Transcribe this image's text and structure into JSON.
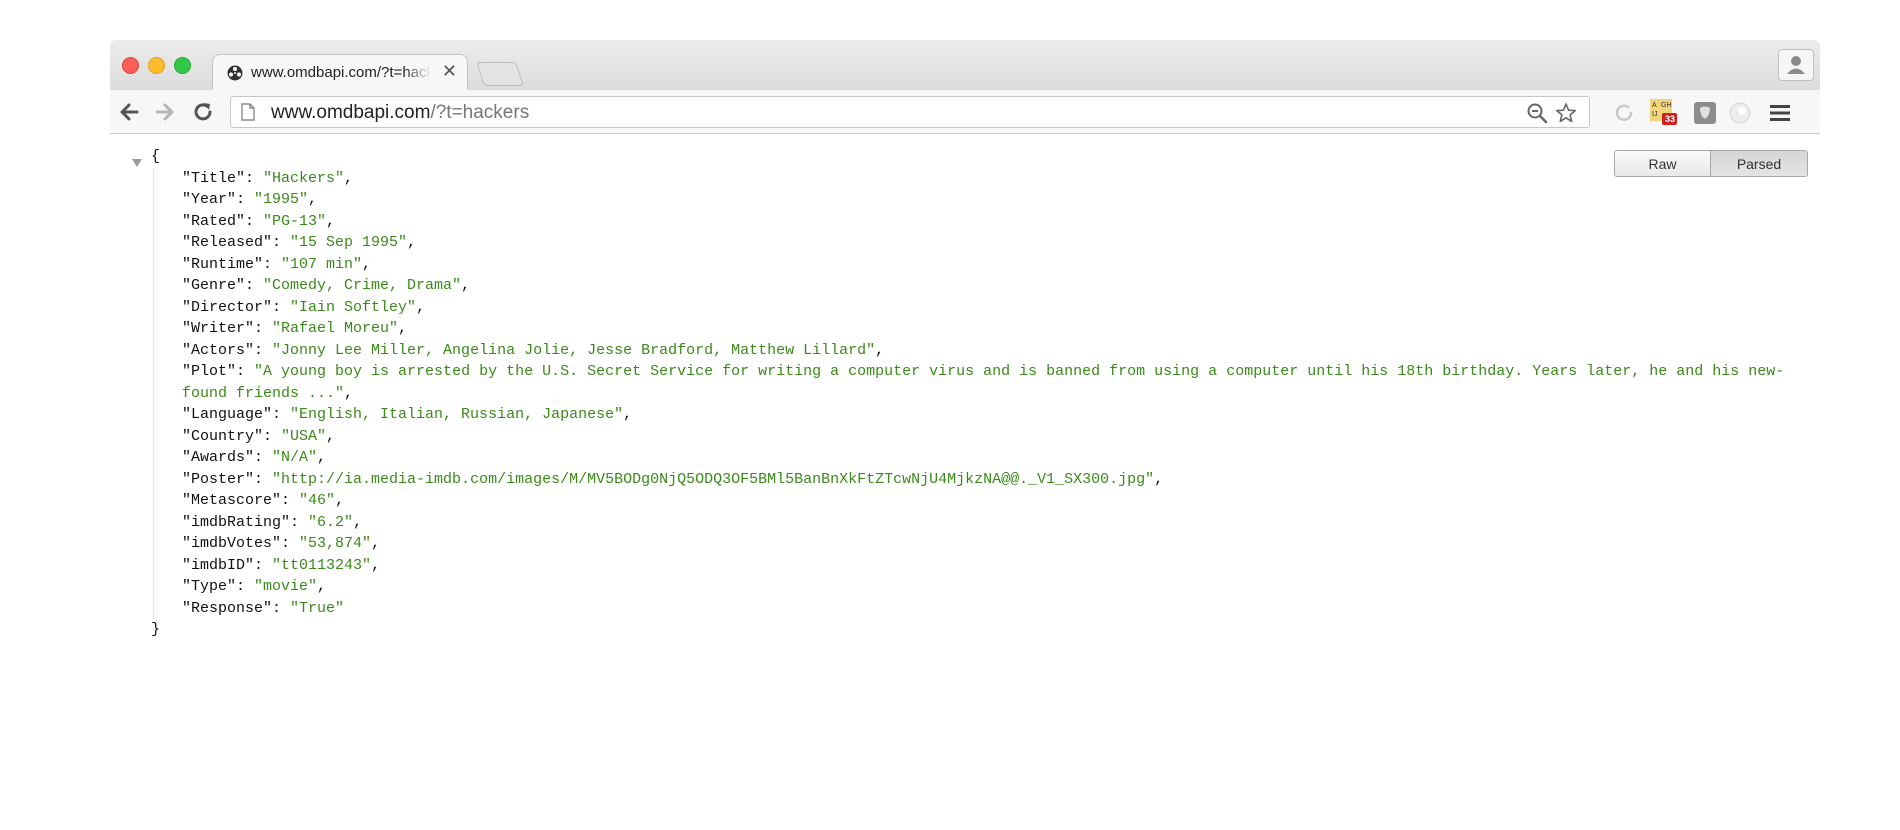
{
  "browser": {
    "tab": {
      "title": "www.omdbapi.com/?t=hackers"
    },
    "address": {
      "host": "www.omdbapi.com",
      "path": "/?t=hackers"
    }
  },
  "viewer": {
    "raw_label": "Raw",
    "parsed_label": "Parsed",
    "mode": "Parsed",
    "open_brace": "{",
    "close_brace": "}"
  },
  "json": {
    "entries": [
      {
        "key": "\"Title\"",
        "value": "\"Hackers\"",
        "trail": ","
      },
      {
        "key": "\"Year\"",
        "value": "\"1995\"",
        "trail": ","
      },
      {
        "key": "\"Rated\"",
        "value": "\"PG-13\"",
        "trail": ","
      },
      {
        "key": "\"Released\"",
        "value": "\"15 Sep 1995\"",
        "trail": ","
      },
      {
        "key": "\"Runtime\"",
        "value": "\"107 min\"",
        "trail": ","
      },
      {
        "key": "\"Genre\"",
        "value": "\"Comedy, Crime, Drama\"",
        "trail": ","
      },
      {
        "key": "\"Director\"",
        "value": "\"Iain Softley\"",
        "trail": ","
      },
      {
        "key": "\"Writer\"",
        "value": "\"Rafael Moreu\"",
        "trail": ","
      },
      {
        "key": "\"Actors\"",
        "value": "\"Jonny Lee Miller, Angelina Jolie, Jesse Bradford, Matthew Lillard\"",
        "trail": ","
      },
      {
        "key": "\"Plot\"",
        "value": "\"A young boy is arrested by the U.S. Secret Service for writing a computer virus and is banned from using a computer until his 18th birthday. Years later, he and his new-found friends ...\"",
        "trail": ","
      },
      {
        "key": "\"Language\"",
        "value": "\"English, Italian, Russian, Japanese\"",
        "trail": ","
      },
      {
        "key": "\"Country\"",
        "value": "\"USA\"",
        "trail": ","
      },
      {
        "key": "\"Awards\"",
        "value": "\"N/A\"",
        "trail": ","
      },
      {
        "key": "\"Poster\"",
        "value": "\"http://ia.media-imdb.com/images/M/MV5BODg0NjQ5ODQ3OF5BMl5BanBnXkFtZTcwNjU4MjkzNA@@._V1_SX300.jpg\"",
        "trail": ","
      },
      {
        "key": "\"Metascore\"",
        "value": "\"46\"",
        "trail": ","
      },
      {
        "key": "\"imdbRating\"",
        "value": "\"6.2\"",
        "trail": ","
      },
      {
        "key": "\"imdbVotes\"",
        "value": "\"53,874\"",
        "trail": ","
      },
      {
        "key": "\"imdbID\"",
        "value": "\"tt0113243\"",
        "trail": ","
      },
      {
        "key": "\"Type\"",
        "value": "\"movie\"",
        "trail": ","
      },
      {
        "key": "\"Response\"",
        "value": "\"True\"",
        "trail": ""
      }
    ]
  },
  "extensions": {
    "letters_badge": "33"
  },
  "colors": {
    "value_green": "#3a8a1a",
    "close_red": "#fc5f57",
    "minimize_yellow": "#fdbc2e",
    "zoom_green": "#33c748"
  },
  "icons": {
    "back": "arrow-left-icon",
    "forward": "arrow-right-icon",
    "reload": "reload-icon",
    "page": "page-icon",
    "zoom": "zoom-icon",
    "bookmark": "star-icon",
    "menu": "hamburger-menu-icon",
    "profile": "person-icon"
  }
}
